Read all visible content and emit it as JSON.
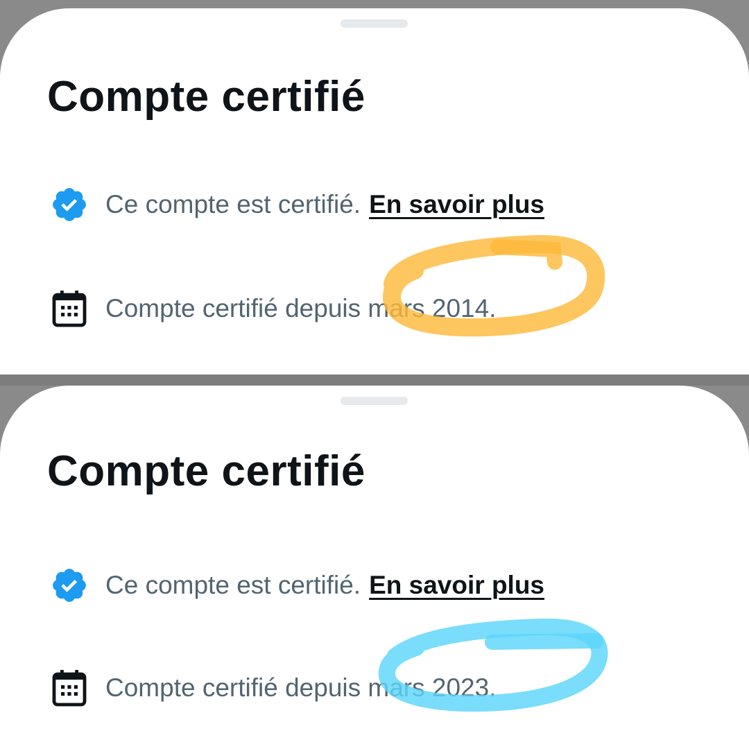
{
  "screenshots": [
    {
      "title": "Compte certifié",
      "verified_text": "Ce compte est certifié.",
      "learn_more_link": "En savoir plus",
      "since_text": "Compte certifié depuis mars 2014.",
      "highlight_color": "#FDBA3B"
    },
    {
      "title": "Compte certifié",
      "verified_text": "Ce compte est certifié.",
      "learn_more_link": "En savoir plus",
      "since_text": "Compte certifié depuis mars 2023.",
      "highlight_color": "#5CD6FA"
    }
  ],
  "colors": {
    "verified_badge": "#1D9BF0",
    "title_text": "#0F1419",
    "body_text": "#536471",
    "handle": "#E6EAED"
  },
  "icons": {
    "verified": "verified-badge-icon",
    "calendar": "calendar-icon"
  }
}
